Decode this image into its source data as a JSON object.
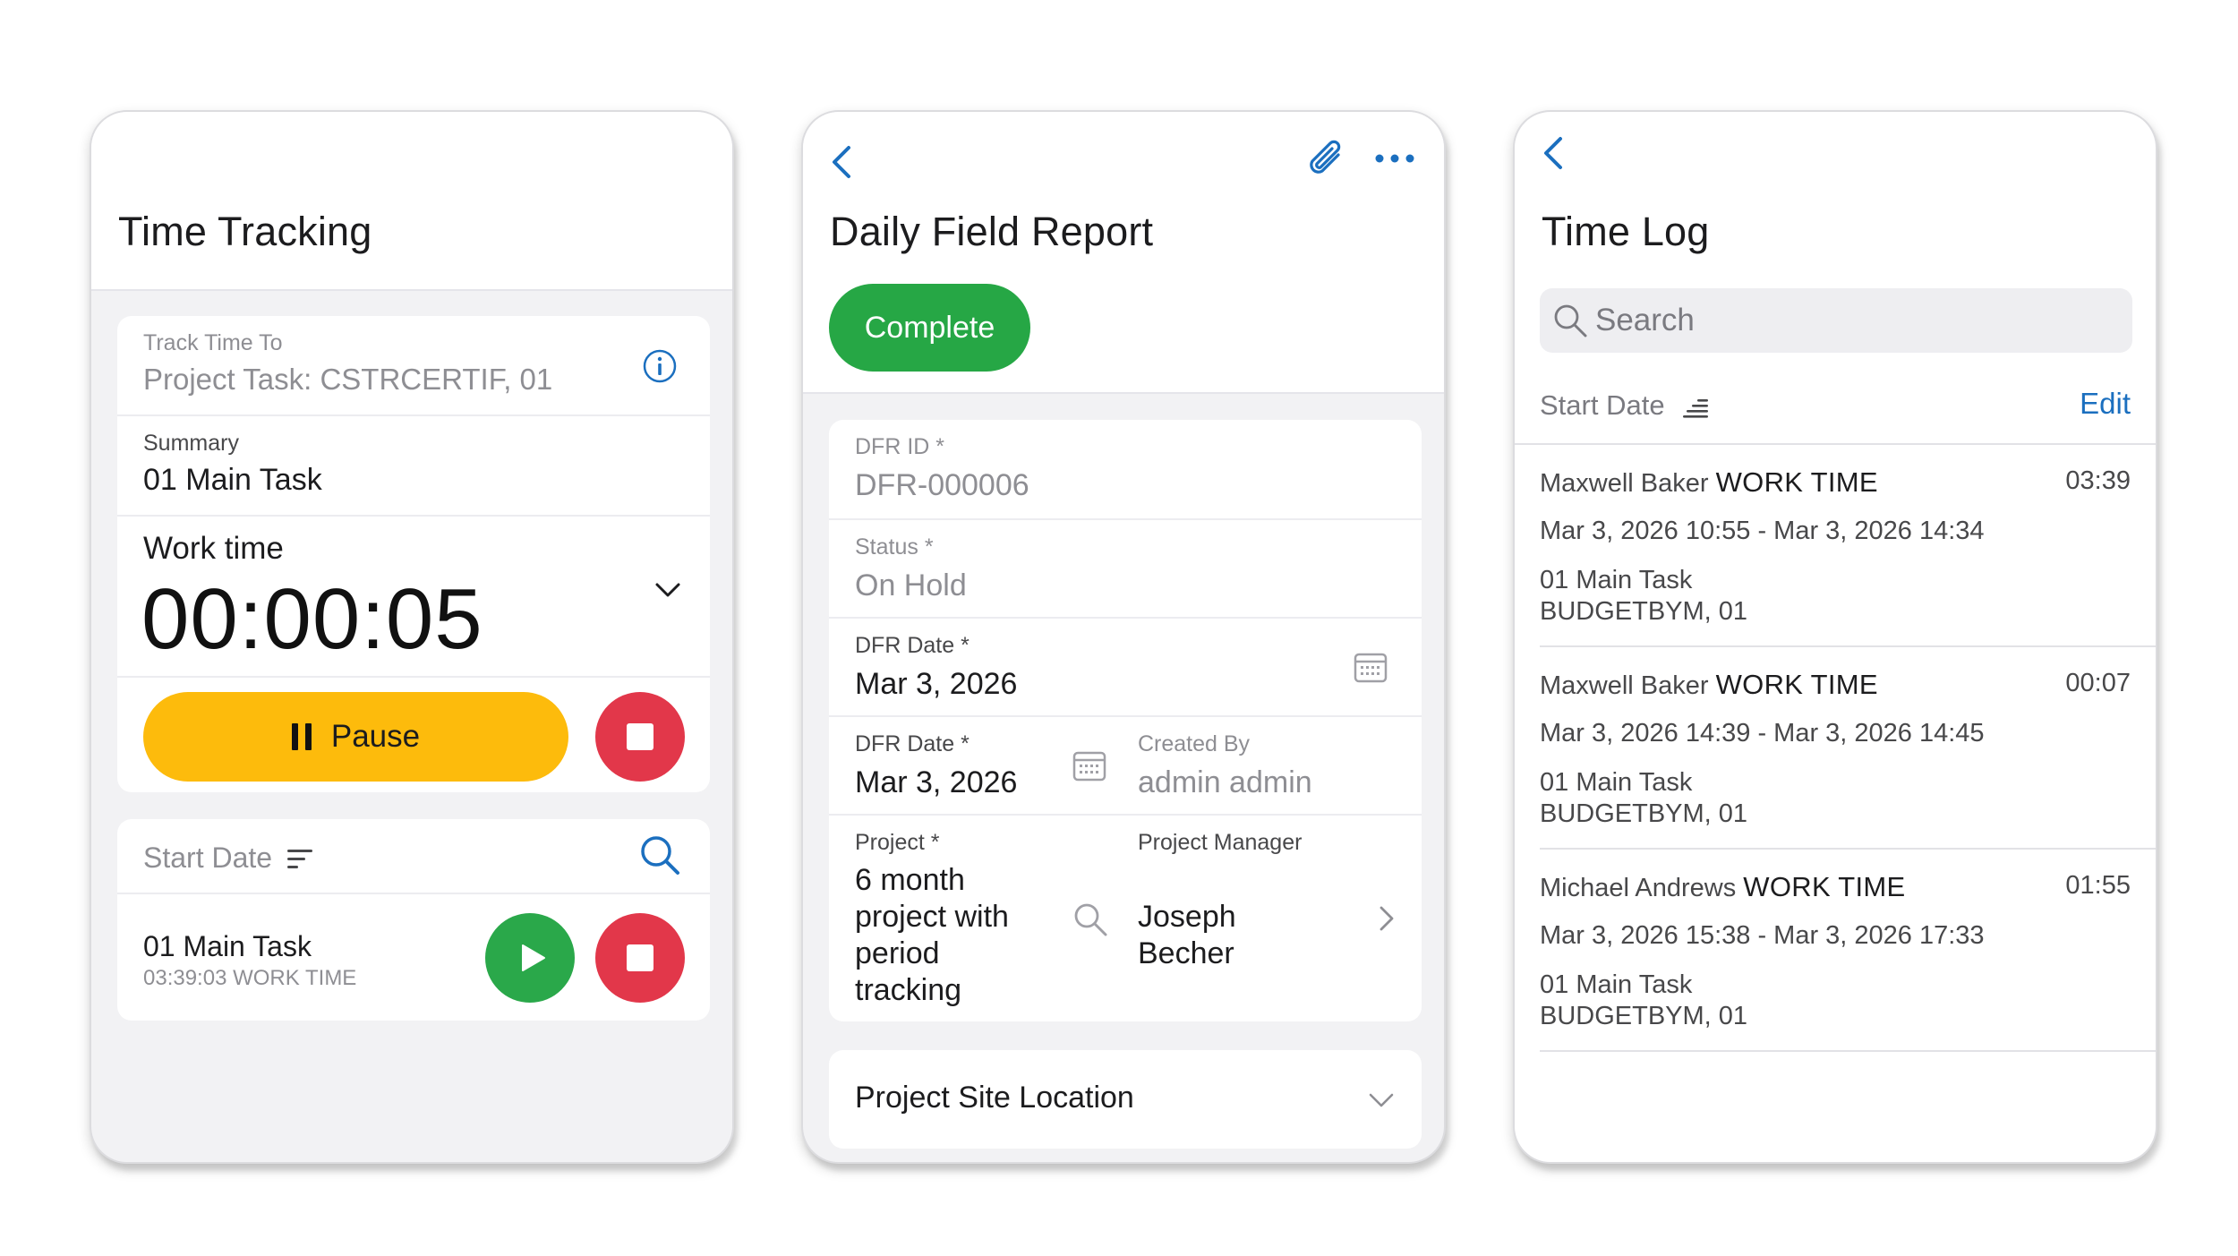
{
  "time_tracking": {
    "title": "Time Tracking",
    "track_time_to_label": "Track Time To",
    "track_time_to_value": "Project Task: CSTRCERTIF, 01",
    "summary_label": "Summary",
    "summary_value": "01 Main Task",
    "work_time_label": "Work time",
    "timer": "00:00:05",
    "pause_label": "Pause",
    "list_sort_label": "Start Date",
    "entries": [
      {
        "title": "01 Main Task",
        "subtitle": "03:39:03 WORK TIME"
      }
    ],
    "colors": {
      "pause": "#fdbb0c",
      "stop": "#e2374a",
      "play": "#2aa84a",
      "accent": "#1b6fbf"
    }
  },
  "daily_field_report": {
    "title": "Daily Field Report",
    "complete_label": "Complete",
    "fields": {
      "dfr_id_label": "DFR ID *",
      "dfr_id_value": "DFR-000006",
      "status_label": "Status *",
      "status_value": "On Hold",
      "dfr_date_label": "DFR Date *",
      "dfr_date_value": "Mar 3, 2026",
      "dfr_date2_label": "DFR Date *",
      "dfr_date2_value": "Mar 3, 2026",
      "created_by_label": "Created By",
      "created_by_value": "admin admin",
      "project_label": "Project *",
      "project_value_lines": [
        "6 month",
        "project with",
        "period",
        "tracking"
      ],
      "project_manager_label": "Project Manager",
      "project_manager_value_lines": [
        "Joseph",
        "Becher"
      ]
    },
    "section_label": "Project Site Location",
    "colors": {
      "complete": "#26a745",
      "accent": "#1b6fbf"
    }
  },
  "time_log": {
    "title": "Time Log",
    "search_placeholder": "Search",
    "sort_label": "Start Date",
    "edit_label": "Edit",
    "entries": [
      {
        "user": "Maxwell Baker",
        "type": "WORK TIME",
        "duration": "03:39",
        "range": "Mar 3, 2026 10:55 - Mar 3, 2026 14:34",
        "task": "01 Main Task",
        "project": "BUDGETBYM, 01"
      },
      {
        "user": "Maxwell Baker",
        "type": "WORK TIME",
        "duration": "00:07",
        "range": "Mar 3, 2026 14:39 - Mar 3, 2026 14:45",
        "task": "01 Main Task",
        "project": "BUDGETBYM, 01"
      },
      {
        "user": "Michael Andrews",
        "type": "WORK TIME",
        "duration": "01:55",
        "range": "Mar 3, 2026 15:38 - Mar 3, 2026 17:33",
        "task": "01 Main Task",
        "project": "BUDGETBYM, 01"
      }
    ],
    "colors": {
      "accent": "#1b6fbf"
    }
  }
}
